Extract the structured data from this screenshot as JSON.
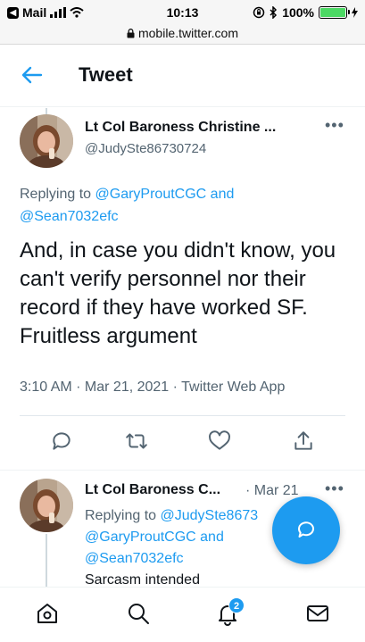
{
  "status_bar": {
    "back_app": "Mail",
    "time": "10:13",
    "battery": "100%",
    "battery_level": 1.0,
    "url": "mobile.twitter.com"
  },
  "header": {
    "title": "Tweet"
  },
  "main_tweet": {
    "display_name": "Lt Col Baroness Christine ...",
    "handle": "@JudySte86730724",
    "replying_prefix": "Replying to ",
    "reply_mention_1": "@GaryProutCGC",
    "reply_and": " and",
    "reply_mention_2": "@Sean7032efc",
    "text": "And, in case you didn't know, you can't verify personnel nor their record if they have worked SF. Fruitless argument",
    "meta": "3:10 AM · Mar 21, 2021 · Twitter Web App"
  },
  "reply_tweet": {
    "display_name": "Lt Col Baroness C...",
    "date": "· Mar 21",
    "replying_prefix": "Replying to ",
    "reply_mention_1": "@JudySte8673",
    "reply_mention_2": "@GaryProutCGC and",
    "reply_mention_3": "@Sean7032efc",
    "text": "Sarcasm intended"
  },
  "bottom_nav": {
    "notifications_badge": "2"
  },
  "colors": {
    "accent": "#1d9bf0",
    "text": "#0f1419",
    "muted": "#536471",
    "battery": "#4cd964"
  },
  "icons": [
    "back-arrow-icon",
    "reply-icon",
    "retweet-icon",
    "like-icon",
    "share-icon",
    "compose-icon",
    "home-icon",
    "search-icon",
    "bell-icon",
    "mail-icon",
    "more-icon"
  ]
}
